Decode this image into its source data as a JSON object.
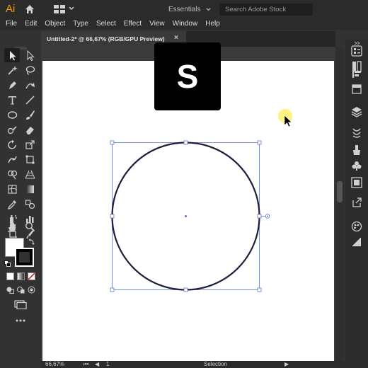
{
  "app": {
    "logo": "Ai",
    "workspace": "Essentials",
    "search_placeholder": "Search Adobe Stock"
  },
  "menu": [
    "File",
    "Edit",
    "Object",
    "Type",
    "Select",
    "Effect",
    "View",
    "Window",
    "Help"
  ],
  "document": {
    "tab_title": "Untitled-2* @ 66,67% (RGB/GPU Preview)",
    "close_glyph": "×"
  },
  "overlay": {
    "key": "S"
  },
  "status": {
    "zoom": "66,67%",
    "page": "1",
    "tool": "Selection"
  },
  "colors": {
    "accent": "#ff9a00",
    "selection": "#5b73c8",
    "cursor_highlight": "#ffee55"
  },
  "icons": {
    "left_toolbar": [
      "selection-tool",
      "direct-selection-tool",
      "magic-wand-tool",
      "lasso-tool",
      "pen-tool",
      "curvature-tool",
      "type-tool",
      "line-tool",
      "ellipse-tool",
      "paintbrush-tool",
      "shaper-tool",
      "eraser-tool",
      "rotate-tool",
      "scale-tool",
      "puppet-warp-tool",
      "free-transform-tool",
      "shape-builder-tool",
      "perspective-grid-tool",
      "mesh-tool",
      "gradient-tool",
      "eyedropper-tool",
      "blend-tool",
      "symbol-sprayer-tool",
      "column-graph-tool",
      "artboard-tool",
      "slice-tool",
      "hand-tool",
      "zoom-tool"
    ],
    "right_panel": [
      "properties-icon",
      "libraries-icon",
      "align-icon",
      "transform-icon",
      "layers-icon",
      "brushes-icon",
      "symbols-icon",
      "graphic-styles-icon",
      "export-icon",
      "color-icon",
      "appearance-icon"
    ]
  }
}
